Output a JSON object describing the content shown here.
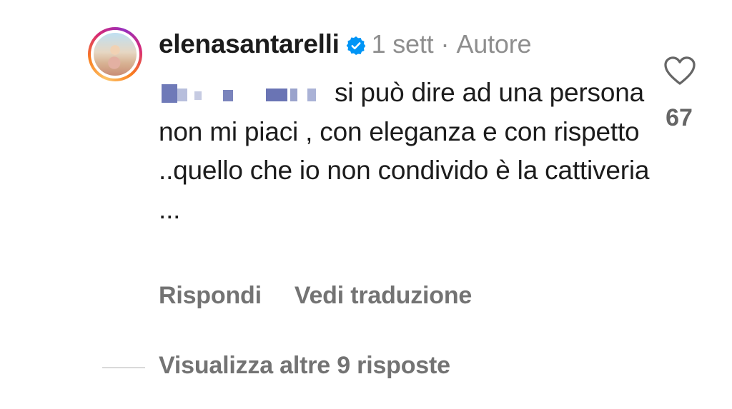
{
  "comment": {
    "username": "elenasantarelli",
    "verified": true,
    "time_ago": "1 sett",
    "separator": "·",
    "author_badge": "Autore",
    "mention_obscured": true,
    "text": "si può dire ad una persona non mi piaci , con eleganza e con rispetto ..quello che io non condivido è la cattiveria ...",
    "like_count": "67",
    "actions": {
      "reply": "Rispondi",
      "translate": "Vedi traduzione"
    },
    "view_replies": "Visualizza altre 9 risposte"
  },
  "icons": {
    "like": "heart-outline-icon",
    "verified": "verified-badge-icon"
  },
  "colors": {
    "username": "#1c1c1c",
    "meta": "#8e8e8e",
    "action": "#737373",
    "verified": "#0095f6",
    "story_ring": [
      "#fdc468",
      "#fa7e1e",
      "#d62976",
      "#962fbf"
    ]
  }
}
